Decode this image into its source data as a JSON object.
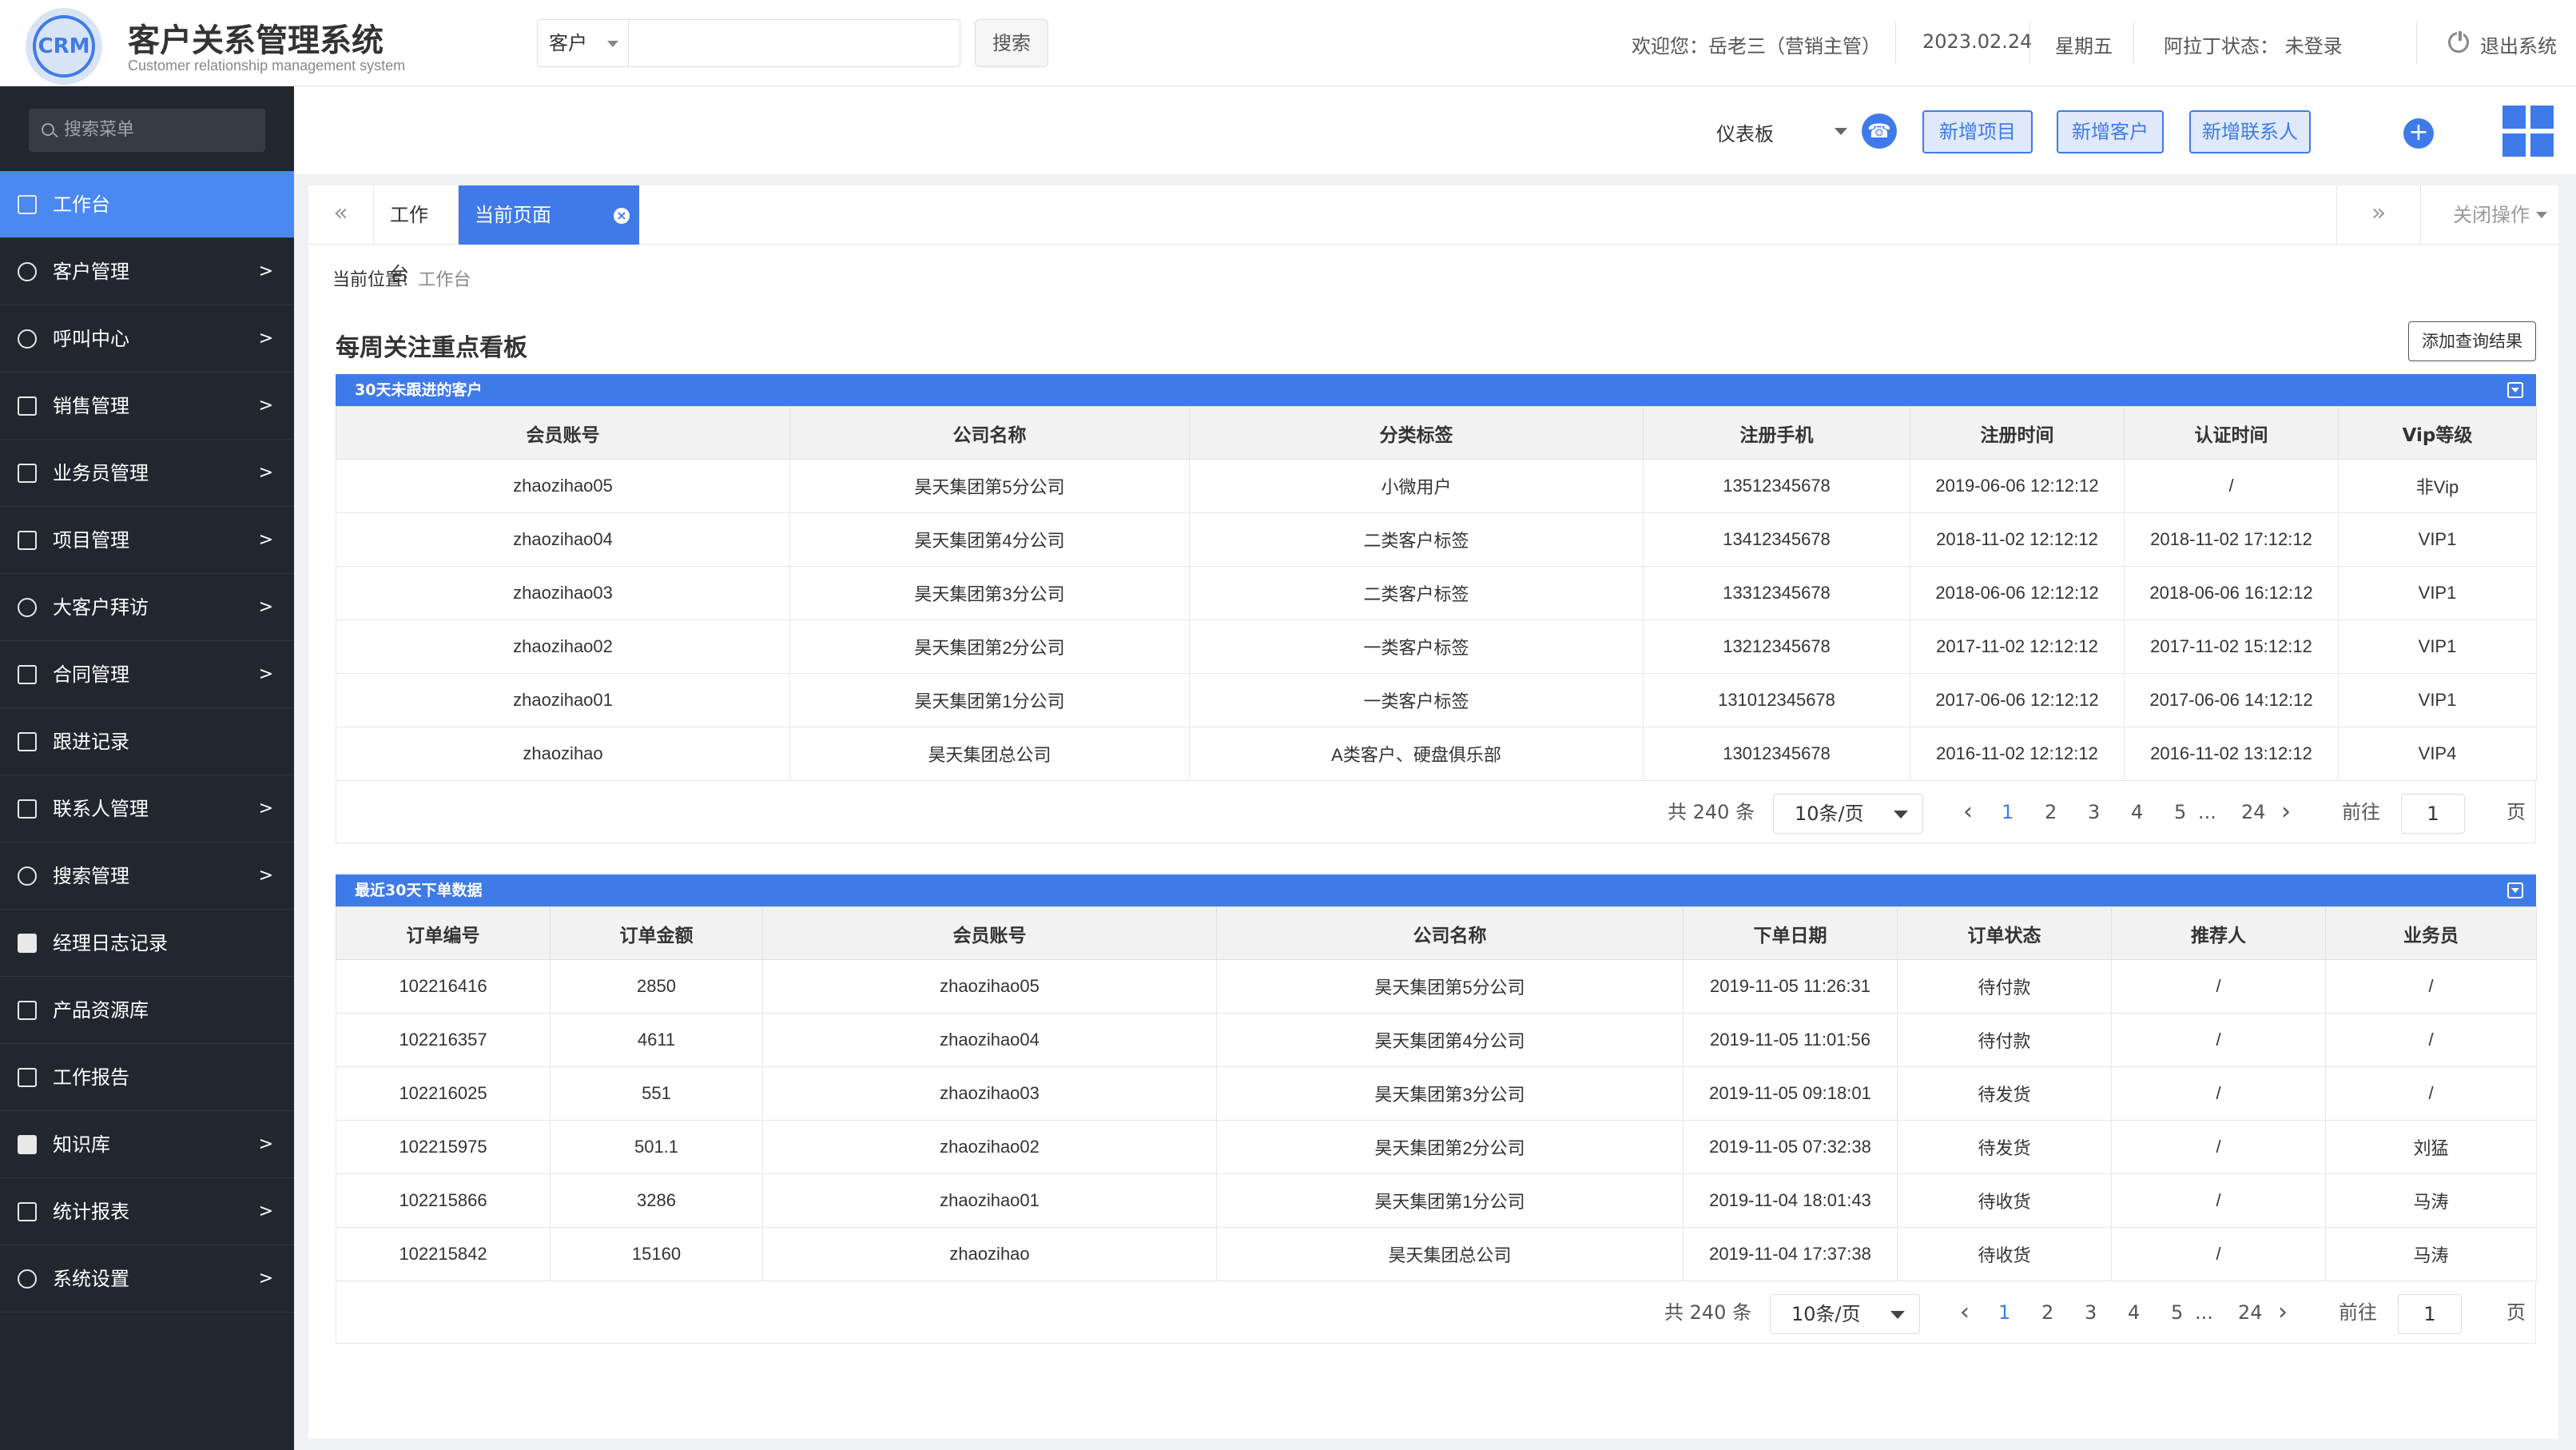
{
  "header": {
    "logo_text": "CRM",
    "title": "客户关系管理系统",
    "subtitle": "Customer relationship management system",
    "search_select": "客户",
    "search_button": "搜索",
    "welcome": "欢迎您：岳老三（营销主管）",
    "date": "2023.02.24",
    "weekday": "星期五",
    "status": "阿拉丁状态：  未登录",
    "logout": "退出系统"
  },
  "sidebar": {
    "search_placeholder": "搜索菜单",
    "items": [
      {
        "label": "工作台",
        "arrow": ""
      },
      {
        "label": "客户管理",
        "arrow": ">"
      },
      {
        "label": "呼叫中心",
        "arrow": ">"
      },
      {
        "label": "销售管理",
        "arrow": ">"
      },
      {
        "label": "业务员管理",
        "arrow": ">"
      },
      {
        "label": "项目管理",
        "arrow": ">"
      },
      {
        "label": "大客户拜访",
        "arrow": ">"
      },
      {
        "label": "合同管理",
        "arrow": ">"
      },
      {
        "label": "跟进记录",
        "arrow": ""
      },
      {
        "label": "联系人管理",
        "arrow": ">"
      },
      {
        "label": "搜索管理",
        "arrow": ">"
      },
      {
        "label": "经理日志记录",
        "arrow": ""
      },
      {
        "label": "产品资源库",
        "arrow": ""
      },
      {
        "label": "工作报告",
        "arrow": ""
      },
      {
        "label": "知识库",
        "arrow": ">"
      },
      {
        "label": "统计报表",
        "arrow": ">"
      },
      {
        "label": "系统设置",
        "arrow": ">"
      }
    ]
  },
  "toolbar": {
    "dashboard": "仪表板",
    "btn_project": "新增项目",
    "btn_customer": "新增客户",
    "btn_contact": "新增联系人"
  },
  "tabs": {
    "prev": "«",
    "next": "»",
    "tab1": "工作台",
    "tab2": "当前页面",
    "close_ops": "关闭操作"
  },
  "crumb": {
    "label": "当前位置:",
    "current": "工作台"
  },
  "board": {
    "title": "每周关注重点看板",
    "add_query": "添加查询结果"
  },
  "panel1": {
    "title": "30天未跟进的客户",
    "columns": [
      "会员账号",
      "公司名称",
      "分类标签",
      "注册手机",
      "注册时间",
      "认证时间",
      "Vip等级"
    ],
    "rows": [
      [
        "zhaozihao05",
        "昊天集团第5分公司",
        "小微用户",
        "13512345678",
        "2019-06-06 12:12:12",
        "/",
        "非Vip"
      ],
      [
        "zhaozihao04",
        "昊天集团第4分公司",
        "二类客户标签",
        "13412345678",
        "2018-11-02 12:12:12",
        "2018-11-02 17:12:12",
        "VIP1"
      ],
      [
        "zhaozihao03",
        "昊天集团第3分公司",
        "二类客户标签",
        "13312345678",
        "2018-06-06 12:12:12",
        "2018-06-06 16:12:12",
        "VIP1"
      ],
      [
        "zhaozihao02",
        "昊天集团第2分公司",
        "一类客户标签",
        "13212345678",
        "2017-11-02 12:12:12",
        "2017-11-02 15:12:12",
        "VIP1"
      ],
      [
        "zhaozihao01",
        "昊天集团第1分公司",
        "一类客户标签",
        "131012345678",
        "2017-06-06 12:12:12",
        "2017-06-06 14:12:12",
        "VIP1"
      ],
      [
        "zhaozihao",
        "昊天集团总公司",
        "A类客户、硬盘俱乐部",
        "13012345678",
        "2016-11-02 12:12:12",
        "2016-11-02 13:12:12",
        "VIP4"
      ]
    ],
    "pager": {
      "total": "共 240 条",
      "page_size": "10条/页",
      "pages": [
        "1",
        "2",
        "3",
        "4",
        "5",
        "...",
        "24"
      ],
      "goto_label": "前往",
      "goto_value": "1",
      "page_suffix": "页"
    }
  },
  "panel2": {
    "title": "最近30天下单数据",
    "columns": [
      "订单编号",
      "订单金额",
      "会员账号",
      "公司名称",
      "下单日期",
      "订单状态",
      "推荐人",
      "业务员"
    ],
    "rows": [
      [
        "102216416",
        "2850",
        "zhaozihao05",
        "昊天集团第5分公司",
        "2019-11-05 11:26:31",
        "待付款",
        "/",
        "/"
      ],
      [
        "102216357",
        "4611",
        "zhaozihao04",
        "昊天集团第4分公司",
        "2019-11-05 11:01:56",
        "待付款",
        "/",
        "/"
      ],
      [
        "102216025",
        "551",
        "zhaozihao03",
        "昊天集团第3分公司",
        "2019-11-05 09:18:01",
        "待发货",
        "/",
        "/"
      ],
      [
        "102215975",
        "501.1",
        "zhaozihao02",
        "昊天集团第2分公司",
        "2019-11-05 07:32:38",
        "待发货",
        "/",
        "刘猛"
      ],
      [
        "102215866",
        "3286",
        "zhaozihao01",
        "昊天集团第1分公司",
        "2019-11-04 18:01:43",
        "待收货",
        "/",
        "马涛"
      ],
      [
        "102215842",
        "15160",
        "zhaozihao",
        "昊天集团总公司",
        "2019-11-04 17:37:38",
        "待收货",
        "/",
        "马涛"
      ]
    ],
    "pager": {
      "total": "共 240 条",
      "page_size": "10条/页",
      "pages": [
        "1",
        "2",
        "3",
        "4",
        "5",
        "...",
        "24"
      ],
      "goto_label": "前往",
      "goto_value": "1",
      "page_suffix": "页"
    }
  }
}
